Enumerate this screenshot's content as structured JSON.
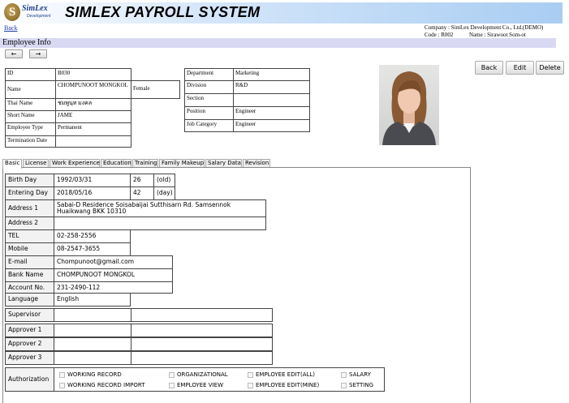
{
  "header": {
    "logo_letter": "S",
    "logo_name": "SimLex",
    "logo_sub": "Development",
    "title": "SIMLEX PAYROLL SYSTEM",
    "back_link": "Back"
  },
  "company": {
    "company": "Company : SimLex Development Co., Ltd.(DEMO)",
    "code": "Code : R002",
    "name": "Name : Sirawoot Som-ot"
  },
  "section_title": "Employee Info",
  "nav": {
    "prev": "←",
    "next": "→"
  },
  "employee": {
    "id_label": "ID",
    "id": "B030",
    "name_label": "Name",
    "name": "CHOMPUNOOT MONGKOL",
    "gender": "Female",
    "thai_label": "Thai Name",
    "thai": "ชมพูนุท มงคล",
    "short_label": "Short Name",
    "short": "JAME",
    "type_label": "Employee Type",
    "type": "Permanent",
    "term_label": "Termination Date",
    "term": ""
  },
  "org": {
    "dept_label": "Department",
    "dept": "Marketing",
    "div_label": "Division",
    "div": "R&D",
    "section_label": "Section",
    "section": "",
    "position_label": "Position",
    "position": "Engineer",
    "jobcat_label": "Job Category",
    "jobcat": "Engineer"
  },
  "actions": {
    "back": "Back",
    "edit": "Edit",
    "delete": "Delete"
  },
  "tabs": [
    "Basic",
    "License",
    "Work Experience",
    "Education",
    "Training",
    "Family Makeup",
    "Salary Data",
    "Revision"
  ],
  "basic": {
    "birth_label": "Birth Day",
    "birth": "1992/03/31",
    "age": "26",
    "age_unit": "(old)",
    "enter_label": "Entering Day",
    "enter": "2018/05/16",
    "days": "42",
    "days_unit": "(day)",
    "addr1_label": "Address 1",
    "addr1": "Sabai-D Residence Soisabaijai Sutthisarn Rd. Samsennok Huaikwang BKK 10310",
    "addr2_label": "Address 2",
    "addr2": "",
    "tel_label": "TEL",
    "tel": "02-258-2556",
    "mobile_label": "Mobile",
    "mobile": "08-2547-3655",
    "email_label": "E-mail",
    "email": "Chompunoot@gmail.com",
    "bank_label": "Bank Name",
    "bank": "CHOMPUNOOT MONGKOL",
    "account_label": "Account No.",
    "account": "231-2490-112",
    "lang_label": "Language",
    "lang": "English",
    "supervisor_label": "Supervisor",
    "approver1_label": "Approver 1",
    "approver2_label": "Approver 2",
    "approver3_label": "Approver 3",
    "auth_label": "Authorization",
    "auth": [
      "WORKING RECORD",
      "ORGANIZATIONAL",
      "EMPLOYEE EDIT(ALL)",
      "SALARY",
      "WORKING RECORD IMPORT",
      "EMPLOYEE VIEW",
      "EMPLOYEE EDIT(MINE)",
      "SETTING"
    ]
  }
}
